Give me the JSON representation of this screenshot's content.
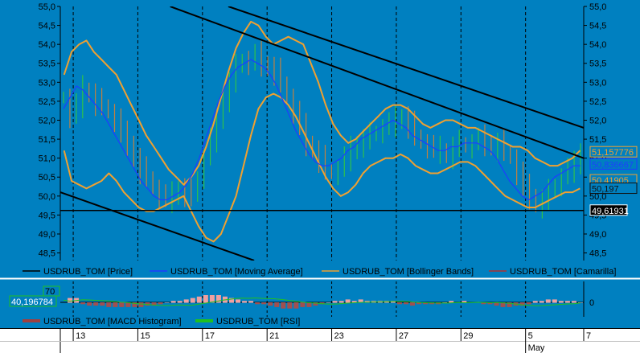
{
  "chart_data": {
    "type": "line",
    "symbol": "USDRUB_TOM",
    "background_color": "#0080c0",
    "price_axis": {
      "ylim": [
        48.3,
        55.0
      ],
      "ticks": [
        "55,0",
        "54,5",
        "54,0",
        "53,5",
        "53,0",
        "52,5",
        "52,0",
        "51,5",
        "51,0",
        "50,5",
        "50,0",
        "49,5",
        "49,0",
        "48,5"
      ],
      "tick_values": [
        55.0,
        54.5,
        54.0,
        53.5,
        53.0,
        52.5,
        52.0,
        51.5,
        51.0,
        50.5,
        50.0,
        49.5,
        49.0,
        48.5
      ]
    },
    "x_axis": {
      "xlim": [
        0,
        81
      ],
      "day_labels": [
        "13",
        "15",
        "17",
        "21",
        "23",
        "27",
        "29",
        "5",
        "7"
      ],
      "day_positions": [
        2,
        12,
        22,
        32,
        42,
        52,
        62,
        72,
        81
      ],
      "month_label": "May",
      "month_position": 72
    },
    "price_series_close": [
      52.6,
      52.1,
      52.4,
      52.8,
      52.7,
      52.5,
      52.4,
      52.2,
      52.0,
      51.6,
      51.4,
      51.0,
      50.7,
      50.5,
      50.2,
      50.0,
      49.9,
      50.0,
      50.2,
      50.1,
      50.0,
      50.5,
      51.0,
      51.5,
      52.0,
      52.6,
      53.0,
      53.4,
      53.6,
      53.5,
      53.7,
      53.5,
      53.4,
      53.3,
      53.0,
      52.6,
      52.2,
      51.8,
      51.4,
      51.2,
      51.0,
      50.7,
      50.6,
      50.7,
      51.0,
      51.2,
      51.4,
      51.5,
      51.6,
      51.7,
      51.8,
      51.9,
      52.0,
      52.1,
      51.9,
      51.6,
      51.4,
      51.3,
      51.2,
      51.2,
      51.1,
      51.3,
      51.4,
      51.3,
      51.4,
      51.5,
      51.4,
      51.3,
      51.4,
      51.2,
      51.0,
      50.6,
      50.2,
      50.0,
      49.8,
      49.9,
      50.1,
      50.3,
      50.5,
      50.7,
      50.8,
      51.2
    ],
    "moving_average": [
      52.3,
      52.6,
      52.9,
      52.8,
      52.6,
      52.4,
      52.2,
      51.9,
      51.6,
      51.3,
      51.0,
      50.7,
      50.4,
      50.2,
      50.0,
      49.9,
      49.9,
      50.0,
      50.1,
      50.3,
      50.6,
      51.0,
      51.5,
      52.0,
      52.5,
      52.9,
      53.2,
      53.4,
      53.5,
      53.6,
      53.5,
      53.4,
      53.2,
      52.9,
      52.5,
      52.1,
      51.7,
      51.4,
      51.1,
      50.9,
      50.8,
      50.8,
      50.9,
      51.0,
      51.2,
      51.3,
      51.5,
      51.6,
      51.7,
      51.8,
      51.9,
      52.0,
      51.9,
      51.8,
      51.6,
      51.5,
      51.4,
      51.3,
      51.2,
      51.2,
      51.3,
      51.3,
      51.4,
      51.4,
      51.4,
      51.3,
      51.2,
      51.0,
      50.7,
      50.4,
      50.2,
      50.0,
      49.9,
      50.0,
      50.1,
      50.3,
      50.5,
      50.6,
      50.7,
      50.8,
      50.8
    ],
    "bollinger_upper": [
      53.2,
      53.8,
      54.0,
      54.1,
      53.8,
      53.6,
      53.4,
      53.2,
      52.8,
      52.4,
      52.0,
      51.6,
      51.3,
      51.0,
      50.7,
      50.5,
      50.3,
      50.5,
      50.8,
      51.3,
      51.9,
      52.6,
      53.3,
      53.9,
      54.3,
      54.6,
      54.5,
      54.2,
      54.0,
      54.1,
      54.2,
      54.1,
      54.0,
      53.5,
      53.0,
      52.4,
      51.9,
      51.6,
      51.4,
      51.5,
      51.7,
      51.9,
      52.1,
      52.3,
      52.4,
      52.4,
      52.3,
      52.1,
      51.9,
      51.8,
      51.9,
      52.0,
      52.0,
      51.9,
      51.8,
      51.8,
      51.7,
      51.6,
      51.5,
      51.4,
      51.3,
      51.3,
      51.2,
      51.0,
      50.9,
      50.8,
      50.8,
      50.9,
      51.0,
      51.2
    ],
    "bollinger_lower": [
      51.2,
      50.4,
      50.3,
      50.2,
      50.3,
      50.4,
      50.6,
      50.4,
      50.1,
      49.9,
      49.7,
      49.6,
      49.6,
      49.7,
      49.8,
      49.9,
      50.0,
      49.6,
      49.2,
      48.9,
      48.8,
      49.0,
      49.5,
      50.0,
      50.8,
      51.6,
      52.3,
      52.6,
      52.7,
      52.6,
      52.4,
      52.1,
      51.7,
      51.3,
      50.9,
      50.5,
      50.2,
      50.0,
      50.1,
      50.3,
      50.6,
      50.8,
      50.9,
      51.0,
      51.0,
      51.1,
      51.0,
      50.8,
      50.7,
      50.6,
      50.6,
      50.7,
      50.8,
      50.9,
      50.9,
      50.8,
      50.6,
      50.4,
      50.2,
      50.0,
      49.9,
      49.8,
      49.7,
      49.7,
      49.8,
      49.9,
      50.0,
      50.1,
      50.1,
      50.2
    ],
    "channel_lines": [
      {
        "x1": 17,
        "y1": 55.0,
        "x2": 81,
        "y2": 51.0
      },
      {
        "x1": 26,
        "y1": 55.0,
        "x2": 81,
        "y2": 51.8
      },
      {
        "x1": 0,
        "y1": 50.1,
        "x2": 30,
        "y2": 48.3
      }
    ],
    "support_level": 49.61931,
    "price_labels": [
      {
        "text": "51,157776",
        "value": 51.157776,
        "color": "#f0a030"
      },
      {
        "text": "50,836667",
        "value": 50.836667,
        "color": "#1e3cff"
      },
      {
        "text": "50,41905",
        "value": 50.41905,
        "color": "#f0a030"
      },
      {
        "text": "50,197",
        "value": 50.197,
        "color": "#101010"
      },
      {
        "text": "49,61931",
        "value": 49.61931,
        "color": "#000000",
        "highlight": true
      }
    ],
    "legend_main": [
      {
        "name": "USDRUB_TOM [Price]",
        "color": "#000000"
      },
      {
        "name": "USDRUB_TOM [Moving Average]",
        "color": "#1e3cff"
      },
      {
        "name": "USDRUB_TOM [Bollinger Bands]",
        "color": "#f0a030"
      },
      {
        "name": "USDRUB_TOM [Camarilla]",
        "color": "#b03030"
      }
    ],
    "indicator_panel": {
      "left_labels": [
        "70",
        "40,196784"
      ],
      "rsi_value": 40.196784,
      "right_tick": "0"
    },
    "legend_indicators": [
      {
        "name": "USDRUB_TOM [MACD Histogram]",
        "color": "#a04040"
      },
      {
        "name": "USDRUB_TOM [RSI]",
        "color": "#20c020"
      }
    ]
  }
}
